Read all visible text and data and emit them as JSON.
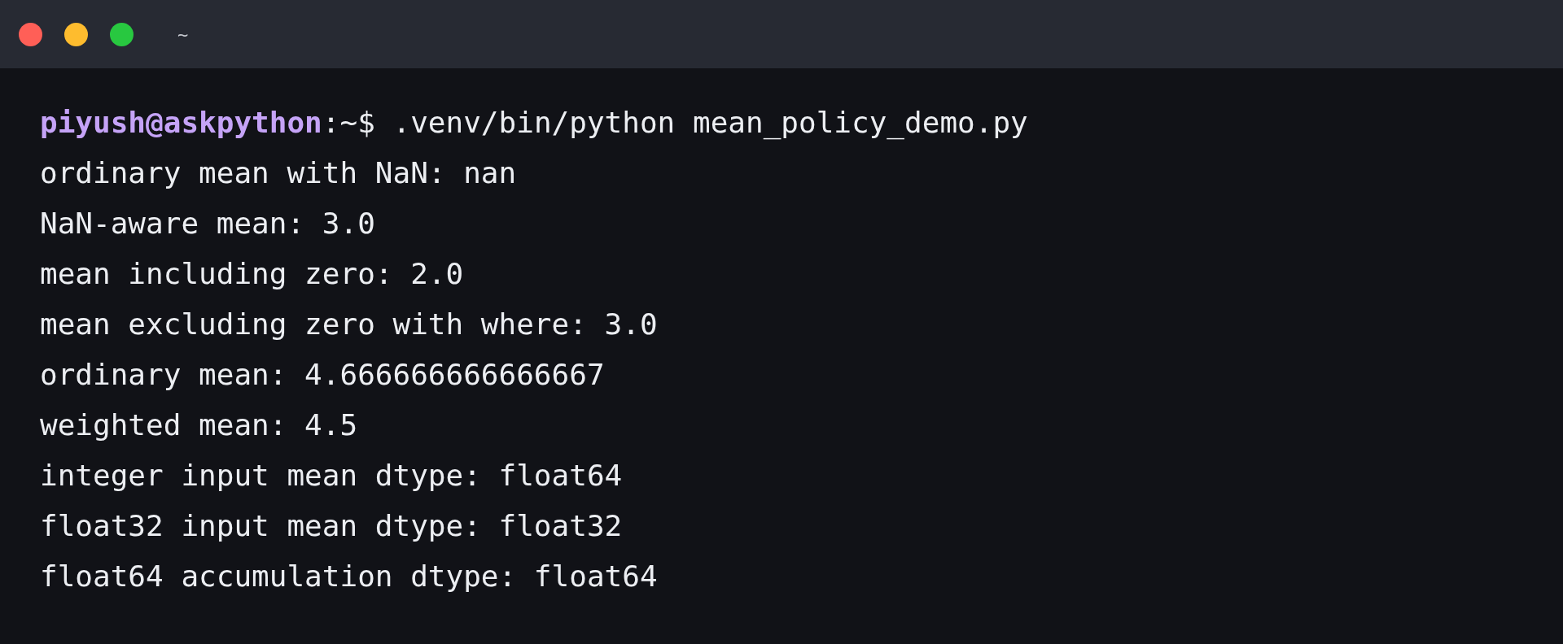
{
  "window": {
    "title": "~"
  },
  "prompt": {
    "user_host": "piyush@askpython",
    "path": ":~$",
    "command": ".venv/bin/python mean_policy_demo.py"
  },
  "output": [
    "ordinary mean with NaN: nan",
    "NaN-aware mean: 3.0",
    "mean including zero: 2.0",
    "mean excluding zero with where: 3.0",
    "ordinary mean: 4.666666666666667",
    "weighted mean: 4.5",
    "integer input mean dtype: float64",
    "float32 input mean dtype: float32",
    "float64 accumulation dtype: float64"
  ]
}
